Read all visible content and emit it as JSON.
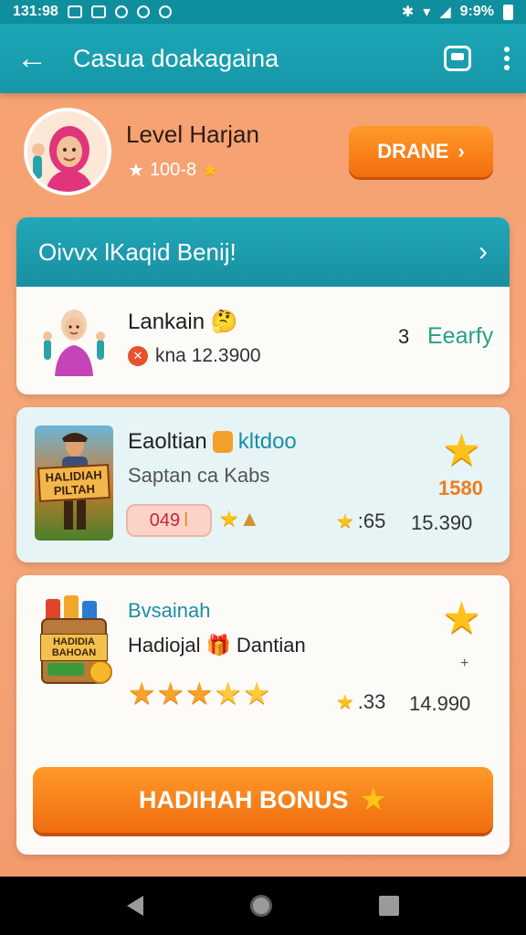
{
  "status_bar": {
    "time": "131:98",
    "battery": "9:9%"
  },
  "app_bar": {
    "title": "Casua doakagaina"
  },
  "profile": {
    "title": "Level Harjan",
    "score": "100-8",
    "button_label": "DRANE"
  },
  "section_card": {
    "header": "Oivvx lKaqid Benij!",
    "item": {
      "name": "Lankain",
      "detail": "kna 12.3900",
      "count": "3",
      "tag": "Eearfy"
    }
  },
  "game_card": {
    "title": "Eaoltian",
    "tag": "kltdoo",
    "subtitle": "Saptan ca Kabs",
    "pill": "049",
    "rating": ":65",
    "count": "15.390",
    "points": "1580",
    "thumb_label": "HALIDIAH PILTAH"
  },
  "reward_card": {
    "title": "Bvsainah",
    "subtitle": "Hadiojal",
    "subtitle_extra": "Dantian",
    "rating": ".33",
    "count": "14.990",
    "stars_count": 5,
    "thumb_label": "HADIDIA BAHOAN",
    "mark": "+",
    "bonus_button": "HADIHAH BONUS"
  },
  "colors": {
    "accent": "#1ca7b6",
    "button": "#f36d0e",
    "background": "#f5a77a"
  }
}
